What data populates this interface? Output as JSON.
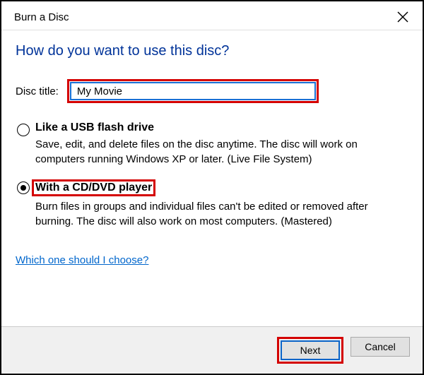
{
  "window": {
    "title": "Burn a Disc"
  },
  "heading": "How do you want to use this disc?",
  "disc_title": {
    "label": "Disc title:",
    "value": "My Movie"
  },
  "options": [
    {
      "title": "Like a USB flash drive",
      "description": "Save, edit, and delete files on the disc anytime. The disc will work on computers running Windows XP or later. (Live File System)",
      "selected": false
    },
    {
      "title": "With a CD/DVD player",
      "description": "Burn files in groups and individual files can't be edited or removed after burning. The disc will also work on most computers. (Mastered)",
      "selected": true
    }
  ],
  "help_link": "Which one should I choose?",
  "buttons": {
    "next": "Next",
    "cancel": "Cancel"
  }
}
